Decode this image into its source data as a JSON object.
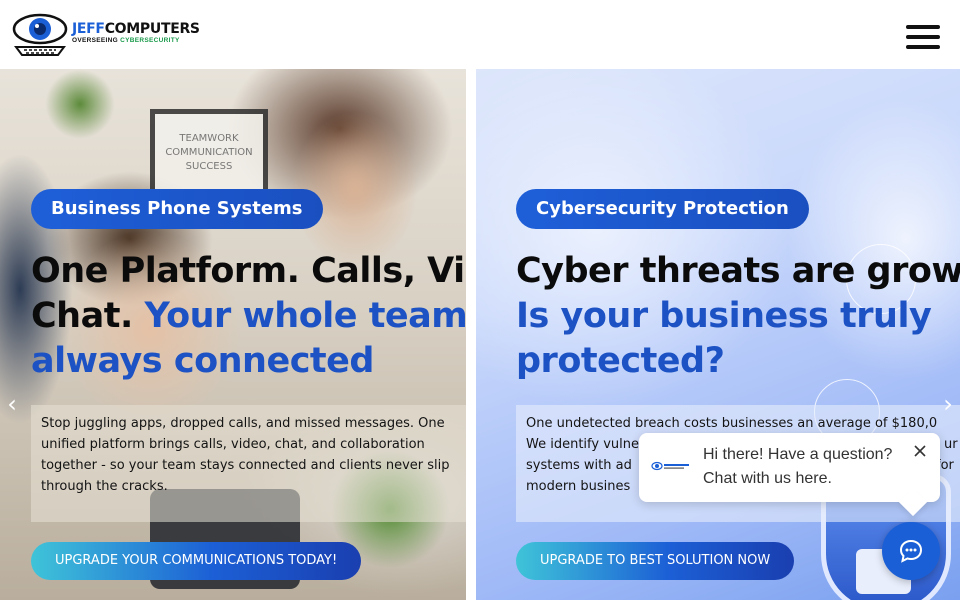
{
  "header": {
    "logo": {
      "brand_part1": "JEFF",
      "brand_part2": "COMPUTERS",
      "tagline_part1": "OVERSEEING ",
      "tagline_part2": "CYBERSECURITY"
    },
    "menu_icon": "hamburger-icon"
  },
  "slides": [
    {
      "badge": "Business Phone Systems",
      "headline_black": "One Platform. Calls, Video",
      "headline_black_2": "Chat. ",
      "headline_blue_1": "Your whole team",
      "headline_blue_2": "always connected",
      "desc_lines": [
        "Stop juggling apps, dropped calls, and missed messages. One",
        "unified platform brings calls, video, chat, and collaboration",
        "together - so your team stays connected and clients never slip",
        "through the cracks."
      ],
      "cta": "UPGRADE YOUR COMMUNICATIONS TODAY!",
      "board_text": [
        "TEAMWORK",
        "COMMUNICATION",
        "SUCCESS"
      ]
    },
    {
      "badge": "Cybersecurity Protection",
      "headline_black": "Cyber threats are growing",
      "headline_blue_1": "Is your business truly",
      "headline_blue_2": "protected?",
      "desc_lines": [
        "One undetected breach costs businesses an average of $180,0",
        "We identify vulne",
        "systems with ad",
        "modern busines"
      ],
      "desc_line2_tail": "ur",
      "desc_line3_tail": "for",
      "cta": "UPGRADE TO BEST SOLUTION NOW"
    }
  ],
  "chat": {
    "line1": "Hi there! Have a question?",
    "line2": "Chat with us here.",
    "close_icon": "close-icon",
    "fab_icon": "chat-bubble-icon"
  },
  "colors": {
    "brand_blue": "#1b5fd6",
    "headline_blue": "#1c52c4",
    "tagline_green": "#1a9a4b"
  }
}
